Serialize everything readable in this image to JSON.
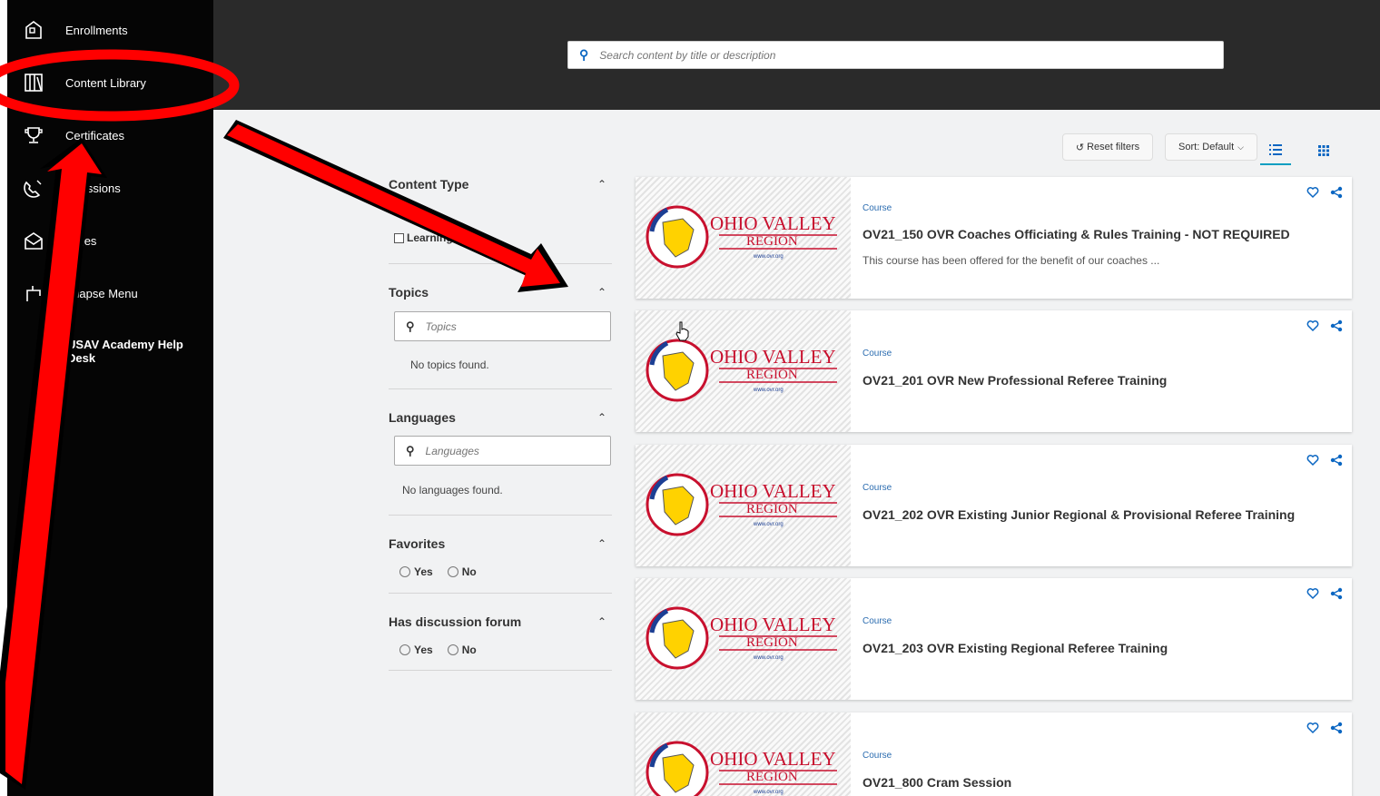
{
  "sidebar": {
    "items": [
      {
        "label": "Enrollments",
        "icon": "enrollments-icon"
      },
      {
        "label": "Content Library",
        "icon": "library-icon"
      },
      {
        "label": "Certificates",
        "icon": "trophy-icon"
      },
      {
        "label": "Sessions",
        "icon": "sessions-icon"
      },
      {
        "label": "essages",
        "icon": "envelope-icon"
      },
      {
        "label": "Collapse Menu",
        "icon": "collapse-icon"
      }
    ],
    "help": "USAV Academy Help Desk"
  },
  "search": {
    "placeholder": "Search content by title or description"
  },
  "toolbar": {
    "reset": "Reset filters",
    "sort": "Sort: Default"
  },
  "filters": {
    "content_type": {
      "title": "Content Type",
      "option": "Learning"
    },
    "topics": {
      "title": "Topics",
      "placeholder": "Topics",
      "empty": "No topics found."
    },
    "languages": {
      "title": "Languages",
      "placeholder": "Languages",
      "empty": "No languages found."
    },
    "favorites": {
      "title": "Favorites",
      "yes": "Yes",
      "no": "No"
    },
    "forum": {
      "title": "Has discussion forum",
      "yes": "Yes",
      "no": "No"
    }
  },
  "logo": {
    "line1": "OHIO VALLEY",
    "line2": "REGION",
    "url": "www.ovr.org"
  },
  "cards": [
    {
      "type": "Course",
      "title": "OV21_150 OVR Coaches Officiating & Rules Training - NOT REQUIRED",
      "desc": "This course has been offered for the benefit of our coaches ..."
    },
    {
      "type": "Course",
      "title": "OV21_201 OVR New Professional Referee Training",
      "desc": ""
    },
    {
      "type": "Course",
      "title": "OV21_202 OVR Existing Junior Regional & Provisional Referee Training",
      "desc": ""
    },
    {
      "type": "Course",
      "title": "OV21_203 OVR Existing Regional Referee Training",
      "desc": ""
    },
    {
      "type": "Course",
      "title": "OV21_800 Cram Session",
      "desc": ""
    }
  ],
  "colors": {
    "annotation": "#ff0000",
    "accent": "#0a9ec2",
    "sidebar": "#050505",
    "topbar": "#2a2a2a"
  }
}
